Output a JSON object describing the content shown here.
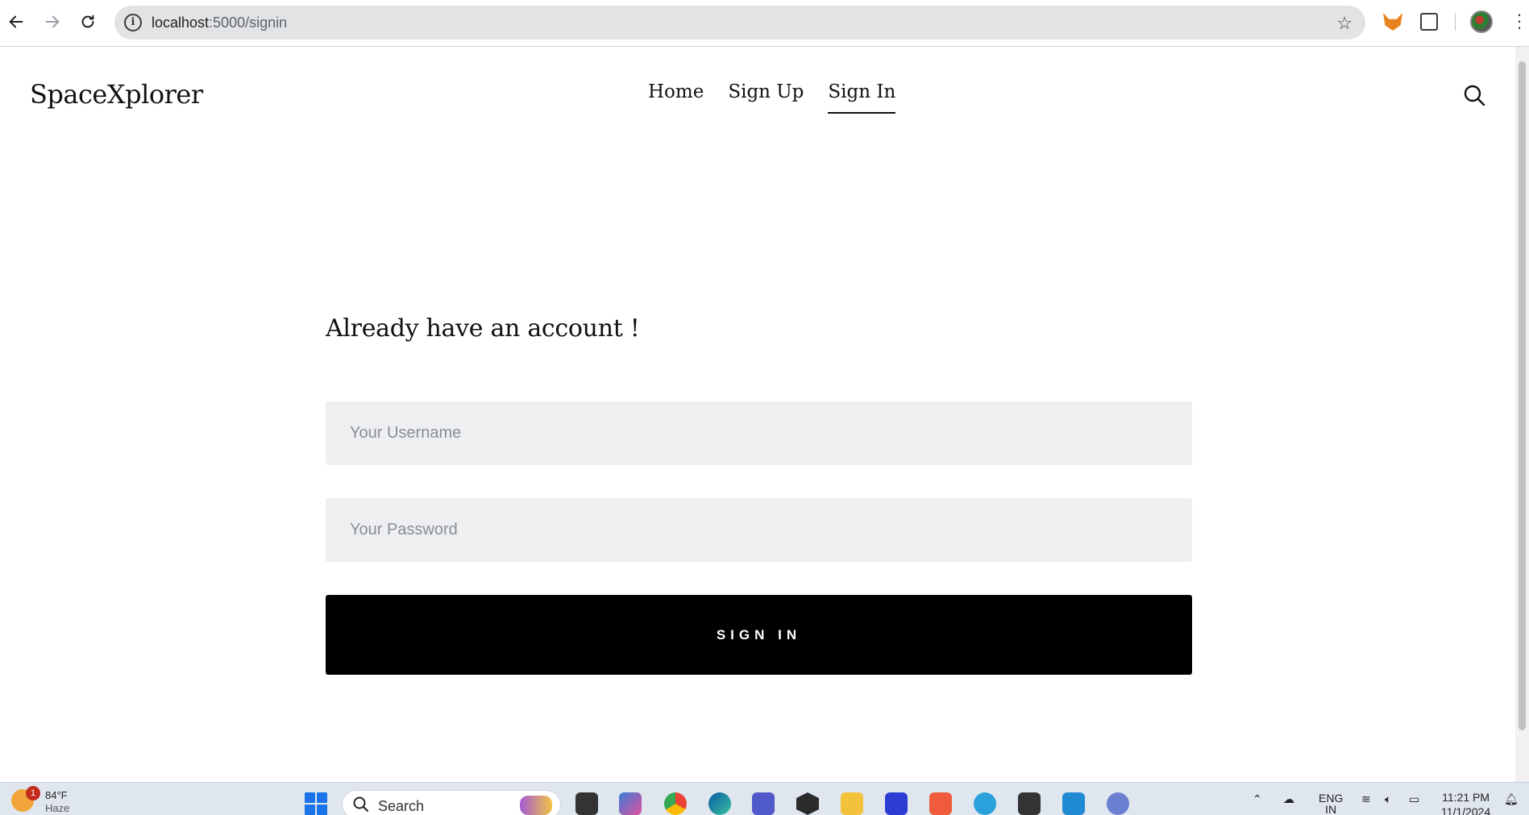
{
  "browser": {
    "url_host": "localhost",
    "url_path": ":5000/signin"
  },
  "site": {
    "brand": "SpaceXplorer",
    "nav": [
      {
        "label": "Home",
        "active": false
      },
      {
        "label": "Sign Up",
        "active": false
      },
      {
        "label": "Sign In",
        "active": true
      }
    ]
  },
  "form": {
    "title": "Already have an account !",
    "username_placeholder": "Your Username",
    "password_placeholder": "Your Password",
    "submit_label": "SIGN IN"
  },
  "taskbar": {
    "weather_temp": "84°F",
    "weather_cond": "Haze",
    "notification_count": "1",
    "search_label": "Search",
    "lang_line1": "ENG",
    "lang_line2": "IN",
    "time": "11:21 PM",
    "date": "11/1/2024"
  },
  "colors": {
    "accent": "#000000",
    "field_bg": "#eeeff1"
  }
}
